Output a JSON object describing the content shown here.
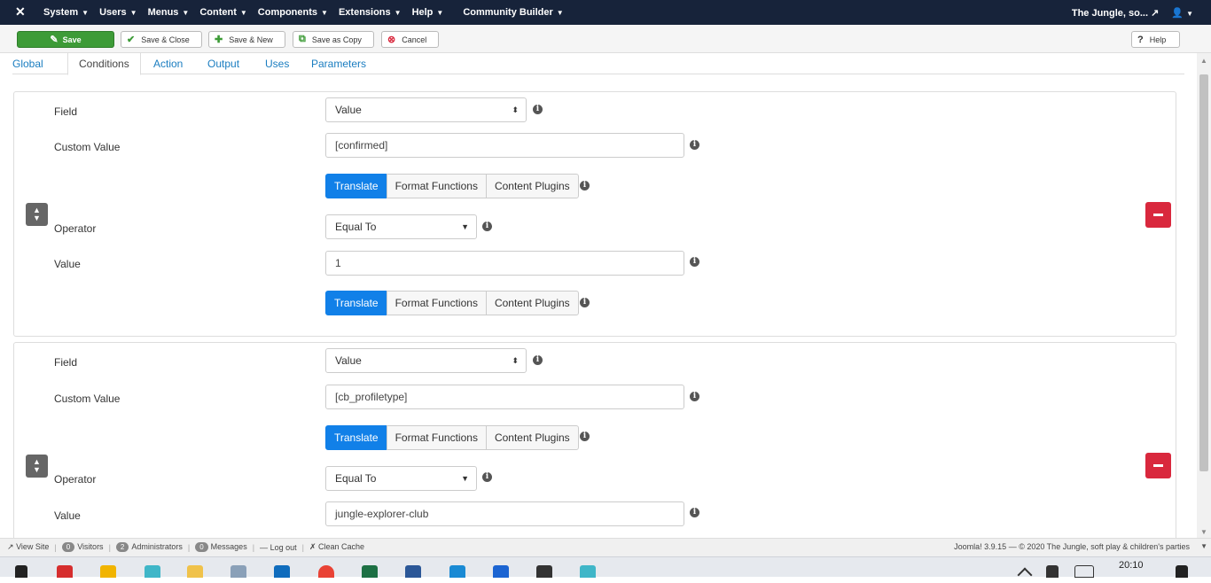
{
  "navbar": {
    "logo": "✕",
    "menu": [
      "System",
      "Users",
      "Menus",
      "Content",
      "Components",
      "Extensions",
      "Help",
      "Community Builder"
    ],
    "site_name": "The Jungle, so...",
    "external_icon": "external-link-icon",
    "user_icon": "user-icon"
  },
  "toolbar": {
    "save": "Save",
    "save_close": "Save & Close",
    "save_new": "Save & New",
    "save_copy": "Save as Copy",
    "cancel": "Cancel",
    "help": "Help"
  },
  "tabs": [
    "Global",
    "Conditions",
    "Action",
    "Output",
    "Uses",
    "Parameters"
  ],
  "active_tab": "Conditions",
  "conditions": [
    {
      "field_label": "Field",
      "field_value": "Value",
      "custom_label": "Custom Value",
      "custom_value": "[confirmed]",
      "buttons": [
        "Translate",
        "Format Functions",
        "Content Plugins"
      ],
      "operator_label": "Operator",
      "operator_value": "Equal To",
      "value_label": "Value",
      "value_value": "1",
      "buttons2": [
        "Translate",
        "Format Functions",
        "Content Plugins"
      ]
    },
    {
      "field_label": "Field",
      "field_value": "Value",
      "custom_label": "Custom Value",
      "custom_value": "[cb_profiletype]",
      "buttons": [
        "Translate",
        "Format Functions",
        "Content Plugins"
      ],
      "operator_label": "Operator",
      "operator_value": "Equal To",
      "value_label": "Value",
      "value_value": "jungle-explorer-club"
    }
  ],
  "statusbar": {
    "view_site": "View Site",
    "visitors_count": "0",
    "visitors": "Visitors",
    "admins_count": "2",
    "admins": "Administrators",
    "messages_count": "0",
    "messages": "Messages",
    "logout": "Log out",
    "clean_cache": "Clean Cache",
    "footer": "Joomla! 3.9.15 — © 2020 The Jungle, soft play & children's parties"
  },
  "taskbar": {
    "clock": "20:10"
  },
  "colors": {
    "navbar": "#17233a",
    "save": "#3d9b37",
    "active_button": "#1180e8",
    "remove": "#d9283d",
    "link": "#1a7dc0"
  }
}
